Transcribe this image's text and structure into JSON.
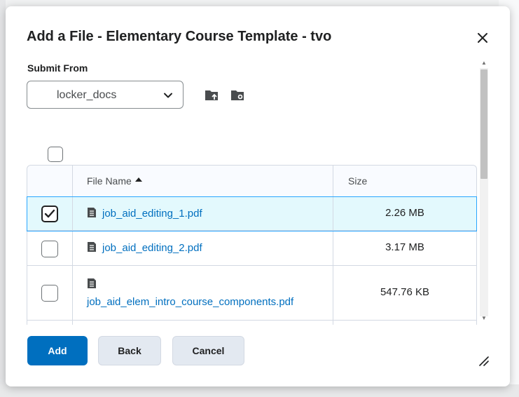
{
  "modal": {
    "title": "Add a File - Elementary Course Template - tvo",
    "submit_from_label": "Submit From",
    "submit_from_value": "locker_docs",
    "table": {
      "columns": [
        {
          "label": "File Name",
          "sort": "ascending"
        },
        {
          "label": "Size"
        }
      ],
      "rows": [
        {
          "name": "job_aid_editing_1.pdf",
          "size": "2.26 MB",
          "checked": true
        },
        {
          "name": "job_aid_editing_2.pdf",
          "size": "3.17 MB",
          "checked": false
        },
        {
          "name": "job_aid_elem_intro_course_components.pdf",
          "size": "547.76 KB",
          "checked": false
        }
      ]
    },
    "buttons": {
      "add": "Add",
      "back": "Back",
      "cancel": "Cancel"
    },
    "icons": {
      "close": "close-icon",
      "upload": "folder-upload-icon",
      "folder_settings": "folder-settings-icon",
      "file": "document-icon",
      "sort": "sort-ascending-icon"
    },
    "colors": {
      "primary": "#006fbf",
      "link": "#006fbf",
      "selected_row": "#e3f9fd",
      "selected_border": "#29a6ff"
    }
  }
}
